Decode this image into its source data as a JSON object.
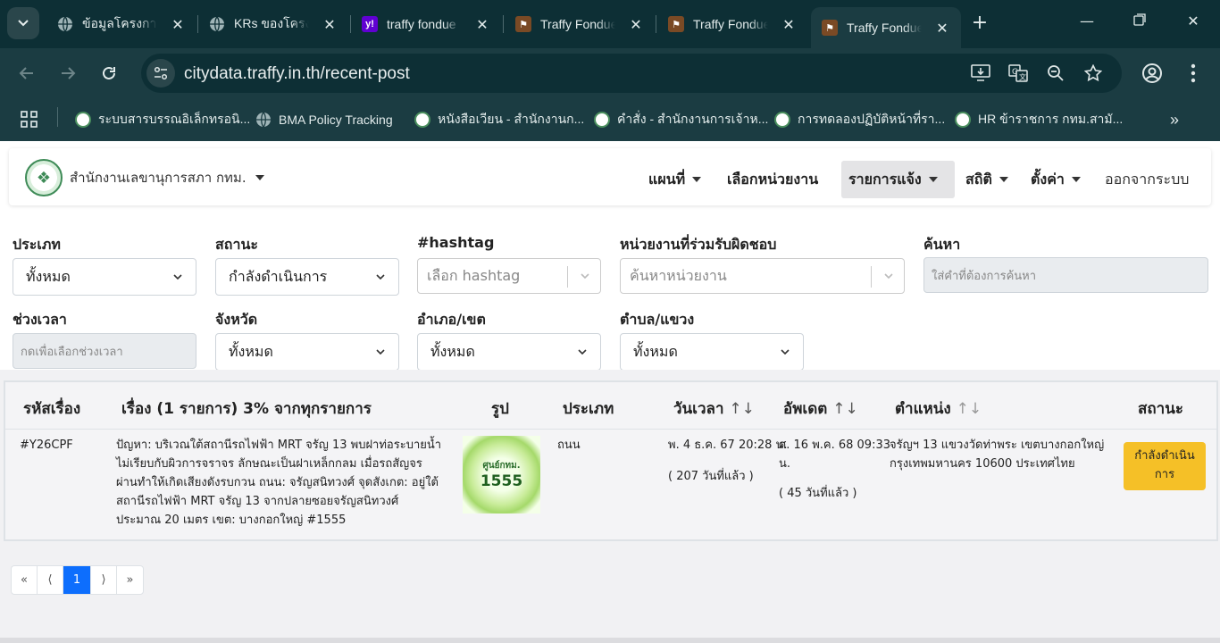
{
  "browser": {
    "tabs": [
      {
        "title": "ข้อมูลโครงการ",
        "favicon": "globe-icon"
      },
      {
        "title": "KRs ของโครงการ",
        "favicon": "globe-icon"
      },
      {
        "title": "traffy fondue",
        "favicon": "yahoo-icon"
      },
      {
        "title": "Traffy Fondue",
        "favicon": "fondue-icon"
      },
      {
        "title": "Traffy Fondue",
        "favicon": "fondue-icon"
      },
      {
        "title": "Traffy Fondue",
        "favicon": "fondue-icon",
        "active": true
      }
    ],
    "url": "citydata.traffy.in.th/recent-post",
    "bookmarks": [
      {
        "label": "ระบบสารบรรณอิเล็กทรอนิ...",
        "icon": "bma-seal-icon"
      },
      {
        "label": "BMA Policy Tracking",
        "icon": "globe-icon"
      },
      {
        "label": "หนังสือเวียน - สำนักงานก...",
        "icon": "bma-seal-icon"
      },
      {
        "label": "คำสั่ง - สำนักงานการเจ้าห...",
        "icon": "bma-seal-icon"
      },
      {
        "label": "การทดลองปฏิบัติหน้าที่รา...",
        "icon": "bma-seal-icon"
      },
      {
        "label": "HR ข้าราชการ กทม.สามั...",
        "icon": "bma-seal-icon"
      }
    ]
  },
  "navbar": {
    "brand": "สำนักงานเลขานุการสภา กทม.",
    "menu": {
      "map": "แผนที่",
      "select_unit": "เลือกหน่วยงาน",
      "reports": "รายการแจ้ง",
      "stats": "สถิติ",
      "settings": "ตั้งค่า",
      "logout": "ออกจากระบบ"
    }
  },
  "filters": {
    "type": {
      "label": "ประเภท",
      "value": "ทั้งหมด"
    },
    "status": {
      "label": "สถานะ",
      "value": "กำลังดำเนินการ"
    },
    "hashtag": {
      "label": "#hashtag",
      "placeholder": "เลือก hashtag"
    },
    "unit": {
      "label": "หน่วยงานที่ร่วมรับผิดชอบ",
      "placeholder": "ค้นหาหน่วยงาน"
    },
    "search": {
      "label": "ค้นหา",
      "placeholder": "ใส่คำที่ต้องการค้นหา"
    },
    "period": {
      "label": "ช่วงเวลา",
      "placeholder": "กดเพื่อเลือกช่วงเวลา"
    },
    "province": {
      "label": "จังหวัด",
      "value": "ทั้งหมด"
    },
    "district": {
      "label": "อำเภอ/เขต",
      "value": "ทั้งหมด"
    },
    "subdistrict": {
      "label": "ตำบล/แขวง",
      "value": "ทั้งหมด"
    }
  },
  "table": {
    "headers": {
      "id": "รหัสเรื่อง",
      "subject": "เรื่อง (1 รายการ) 3% จากทุกรายการ",
      "image": "รูป",
      "type": "ประเภท",
      "datetime": "วันเวลา",
      "updated": "อัพเดต",
      "location": "ตำแหน่ง",
      "status": "สถานะ"
    },
    "sort_glyph": "↑↓",
    "rows": [
      {
        "id": "#Y26CPF",
        "subject_lines": [
          "ปัญหา: บริเวณใต้สถานีรถไฟฟ้า MRT จรัญ 13 พบฝาท่อระบายน้ำ",
          "ไม่เรียบกับผิวการจราจร ลักษณะเป็นฝาเหล็กกลม เมื่อรถสัญจร",
          "ผ่านทำให้เกิดเสียงดังรบกวน ถนน: จรัญสนิทวงศ์ จุดสังเกต: อยู่ใต้",
          "สถานีรถไฟฟ้า MRT จรัญ 13 จากปลายซอยจรัญสนิทวงศ์",
          "ประมาณ 20 เมตร เขต: บางกอกใหญ่ #1555"
        ],
        "thumb_line1": "ศูนย์กทม.",
        "thumb_line2": "1555",
        "type": "ถนน",
        "datetime": "พ. 4 ธ.ค. 67 20:28 น.",
        "datetime_ago": "( 207 วันที่แล้ว )",
        "updated_line1": "ศ. 16 พ.ค. 68 09:33",
        "updated_line2": "น.",
        "updated_ago": "( 45 วันที่แล้ว )",
        "location_line1": "จรัญฯ 13 แขวงวัดท่าพระ เขตบางกอกใหญ่",
        "location_line2": "กรุงเทพมหานคร 10600 ประเทศไทย",
        "status_line1": "กำลังดำเนิน",
        "status_line2": "การ",
        "status_color": "#f5c027"
      }
    ]
  },
  "pagination": {
    "first": "«",
    "prev": "⟨",
    "current": "1",
    "next": "⟩",
    "last": "»"
  }
}
